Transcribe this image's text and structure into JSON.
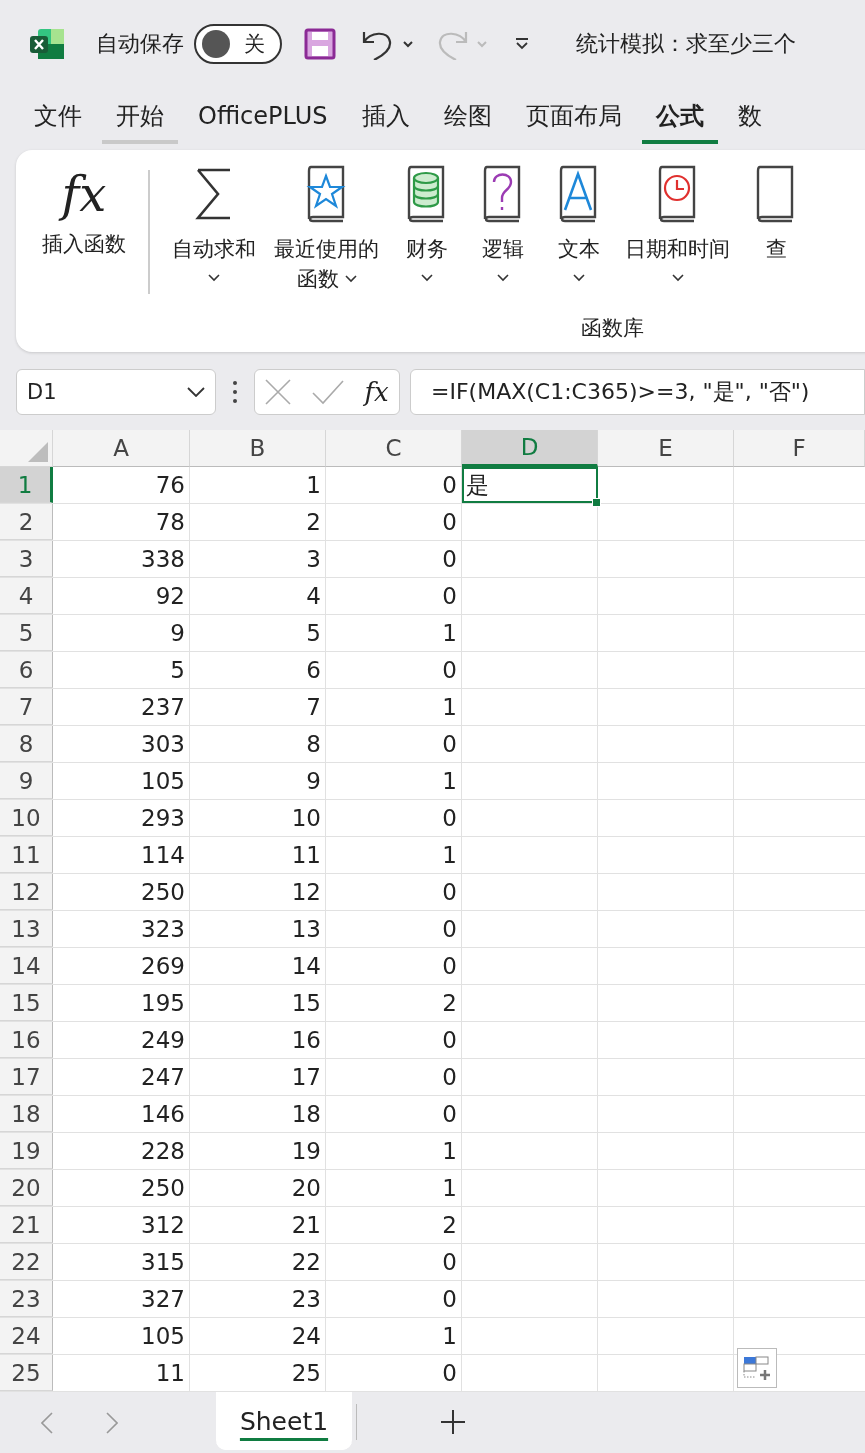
{
  "title_bar": {
    "autosave_label": "自动保存",
    "autosave": {
      "on": false,
      "label": "关"
    },
    "undo": {
      "disabled": false
    },
    "redo": {
      "disabled": true
    },
    "title": "统计模拟：求至少三个"
  },
  "tabs": [
    {
      "label": "文件",
      "selected": false,
      "hovered": false
    },
    {
      "label": "开始",
      "selected": false,
      "hovered": true
    },
    {
      "label": "OfficePLUS",
      "selected": false,
      "hovered": false
    },
    {
      "label": "插入",
      "selected": false,
      "hovered": false
    },
    {
      "label": "绘图",
      "selected": false,
      "hovered": false
    },
    {
      "label": "页面布局",
      "selected": false,
      "hovered": false
    },
    {
      "label": "公式",
      "selected": true,
      "hovered": false
    },
    {
      "label": "数",
      "selected": false,
      "hovered": false
    }
  ],
  "ribbon": {
    "insert_function": {
      "icon_text": "fx",
      "label": "插入函数"
    },
    "items": [
      {
        "kind": "sum",
        "label": "自动求和",
        "dropdown": true
      },
      {
        "kind": "star",
        "label": "最近使用的函数",
        "dropdown": true
      },
      {
        "kind": "database",
        "label": "财务",
        "dropdown": true
      },
      {
        "kind": "question",
        "label": "逻辑",
        "dropdown": true
      },
      {
        "kind": "letter",
        "label": "文本",
        "dropdown": true
      },
      {
        "kind": "clock",
        "label": "日期和时间",
        "dropdown": true
      },
      {
        "kind": "book",
        "label": "查",
        "dropdown": false
      }
    ],
    "group_label": "函数库"
  },
  "formula_bar": {
    "name_box": "D1",
    "fx": "fx",
    "formula": "=IF(MAX(C1:C365)>=3, \"是\", \"否\")"
  },
  "columns": [
    {
      "label": "A",
      "selected": false
    },
    {
      "label": "B",
      "selected": false
    },
    {
      "label": "C",
      "selected": false
    },
    {
      "label": "D",
      "selected": true
    },
    {
      "label": "E",
      "selected": false
    },
    {
      "label": "F",
      "selected": false
    }
  ],
  "rows": [
    {
      "header": "1",
      "selected": true,
      "cells": [
        {
          "text": "76",
          "selected": false
        },
        {
          "text": "1",
          "selected": false
        },
        {
          "text": "0",
          "selected": false
        },
        {
          "text": "是",
          "selected": true
        }
      ]
    },
    {
      "header": "2",
      "selected": false,
      "cells": [
        {
          "text": "78",
          "selected": false
        },
        {
          "text": "2",
          "selected": false
        },
        {
          "text": "0",
          "selected": false
        }
      ]
    },
    {
      "header": "3",
      "selected": false,
      "cells": [
        {
          "text": "338",
          "selected": false
        },
        {
          "text": "3",
          "selected": false
        },
        {
          "text": "0",
          "selected": false
        }
      ]
    },
    {
      "header": "4",
      "selected": false,
      "cells": [
        {
          "text": "92",
          "selected": false
        },
        {
          "text": "4",
          "selected": false
        },
        {
          "text": "0",
          "selected": false
        }
      ]
    },
    {
      "header": "5",
      "selected": false,
      "cells": [
        {
          "text": "9",
          "selected": false
        },
        {
          "text": "5",
          "selected": false
        },
        {
          "text": "1",
          "selected": false
        }
      ]
    },
    {
      "header": "6",
      "selected": false,
      "cells": [
        {
          "text": "5",
          "selected": false
        },
        {
          "text": "6",
          "selected": false
        },
        {
          "text": "0",
          "selected": false
        }
      ]
    },
    {
      "header": "7",
      "selected": false,
      "cells": [
        {
          "text": "237",
          "selected": false
        },
        {
          "text": "7",
          "selected": false
        },
        {
          "text": "1",
          "selected": false
        }
      ]
    },
    {
      "header": "8",
      "selected": false,
      "cells": [
        {
          "text": "303",
          "selected": false
        },
        {
          "text": "8",
          "selected": false
        },
        {
          "text": "0",
          "selected": false
        }
      ]
    },
    {
      "header": "9",
      "selected": false,
      "cells": [
        {
          "text": "105",
          "selected": false
        },
        {
          "text": "9",
          "selected": false
        },
        {
          "text": "1",
          "selected": false
        }
      ]
    },
    {
      "header": "10",
      "selected": false,
      "cells": [
        {
          "text": "293",
          "selected": false
        },
        {
          "text": "10",
          "selected": false
        },
        {
          "text": "0",
          "selected": false
        }
      ]
    },
    {
      "header": "11",
      "selected": false,
      "cells": [
        {
          "text": "114",
          "selected": false
        },
        {
          "text": "11",
          "selected": false
        },
        {
          "text": "1",
          "selected": false
        }
      ]
    },
    {
      "header": "12",
      "selected": false,
      "cells": [
        {
          "text": "250",
          "selected": false
        },
        {
          "text": "12",
          "selected": false
        },
        {
          "text": "0",
          "selected": false
        }
      ]
    },
    {
      "header": "13",
      "selected": false,
      "cells": [
        {
          "text": "323",
          "selected": false
        },
        {
          "text": "13",
          "selected": false
        },
        {
          "text": "0",
          "selected": false
        }
      ]
    },
    {
      "header": "14",
      "selected": false,
      "cells": [
        {
          "text": "269",
          "selected": false
        },
        {
          "text": "14",
          "selected": false
        },
        {
          "text": "0",
          "selected": false
        }
      ]
    },
    {
      "header": "15",
      "selected": false,
      "cells": [
        {
          "text": "195",
          "selected": false
        },
        {
          "text": "15",
          "selected": false
        },
        {
          "text": "2",
          "selected": false
        }
      ]
    },
    {
      "header": "16",
      "selected": false,
      "cells": [
        {
          "text": "249",
          "selected": false
        },
        {
          "text": "16",
          "selected": false
        },
        {
          "text": "0",
          "selected": false
        }
      ]
    },
    {
      "header": "17",
      "selected": false,
      "cells": [
        {
          "text": "247",
          "selected": false
        },
        {
          "text": "17",
          "selected": false
        },
        {
          "text": "0",
          "selected": false
        }
      ]
    },
    {
      "header": "18",
      "selected": false,
      "cells": [
        {
          "text": "146",
          "selected": false
        },
        {
          "text": "18",
          "selected": false
        },
        {
          "text": "0",
          "selected": false
        }
      ]
    },
    {
      "header": "19",
      "selected": false,
      "cells": [
        {
          "text": "228",
          "selected": false
        },
        {
          "text": "19",
          "selected": false
        },
        {
          "text": "1",
          "selected": false
        }
      ]
    },
    {
      "header": "20",
      "selected": false,
      "cells": [
        {
          "text": "250",
          "selected": false
        },
        {
          "text": "20",
          "selected": false
        },
        {
          "text": "1",
          "selected": false
        }
      ]
    },
    {
      "header": "21",
      "selected": false,
      "cells": [
        {
          "text": "312",
          "selected": false
        },
        {
          "text": "21",
          "selected": false
        },
        {
          "text": "2",
          "selected": false
        }
      ]
    },
    {
      "header": "22",
      "selected": false,
      "cells": [
        {
          "text": "315",
          "selected": false
        },
        {
          "text": "22",
          "selected": false
        },
        {
          "text": "0",
          "selected": false
        }
      ]
    },
    {
      "header": "23",
      "selected": false,
      "cells": [
        {
          "text": "327",
          "selected": false
        },
        {
          "text": "23",
          "selected": false
        },
        {
          "text": "0",
          "selected": false
        }
      ]
    },
    {
      "header": "24",
      "selected": false,
      "cells": [
        {
          "text": "105",
          "selected": false
        },
        {
          "text": "24",
          "selected": false
        },
        {
          "text": "1",
          "selected": false
        }
      ]
    },
    {
      "header": "25",
      "selected": false,
      "cells": [
        {
          "text": "11",
          "selected": false
        },
        {
          "text": "25",
          "selected": false
        },
        {
          "text": "0",
          "selected": false
        }
      ]
    }
  ],
  "sheet_tabs": [
    {
      "label": "Sheet1",
      "selected": true
    }
  ]
}
